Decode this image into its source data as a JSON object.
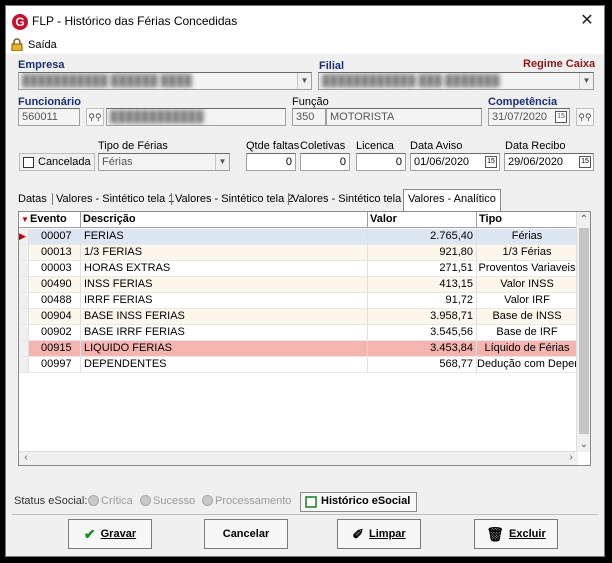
{
  "window": {
    "title": "FLP - Histórico das Férias Concedidas",
    "app_icon": "G"
  },
  "menu": {
    "exit_label": "Saída"
  },
  "labels": {
    "empresa": "Empresa",
    "filial": "Filial",
    "regime": "Regime Caixa",
    "funcionario": "Funcionário",
    "funcao": "Função",
    "competencia": "Competência",
    "tipo_ferias": "Tipo de Férias",
    "qtde_faltas": "Qtde faltas",
    "coletivas": "Coletivas",
    "licenca": "Licenca",
    "data_aviso": "Data Aviso",
    "data_recibo": "Data Recibo"
  },
  "fields": {
    "empresa": "███████████ ██████ ████",
    "filial": "████████████ ███ ███████",
    "funcionario_codigo": "560011",
    "funcionario_nome": "████████████",
    "funcao_codigo": "350",
    "funcao_nome": "MOTORISTA",
    "competencia": "31/07/2020",
    "tipo_ferias": "Férias",
    "qtde_faltas": "0",
    "coletivas": "0",
    "licenca": "0",
    "data_aviso": "01/06/2020",
    "data_recibo": "29/06/2020",
    "cancelada_label": "Cancelada"
  },
  "tabs": [
    "Datas",
    "Valores - Sintético tela 1",
    "Valores - Sintético tela 2",
    "Valores - Sintético tela 3",
    "Valores - Analítico"
  ],
  "grid": {
    "headers": [
      "Evento",
      "Descrição",
      "Valor",
      "Tipo"
    ],
    "rows": [
      {
        "evento": "00007",
        "descricao": "FERIAS",
        "valor": "2.765,40",
        "tipo": "Férias"
      },
      {
        "evento": "00013",
        "descricao": "1/3 FERIAS",
        "valor": "921,80",
        "tipo": "1/3 Férias"
      },
      {
        "evento": "00003",
        "descricao": "HORAS EXTRAS",
        "valor": "271,51",
        "tipo": "Proventos Variaveis"
      },
      {
        "evento": "00490",
        "descricao": "INSS FERIAS",
        "valor": "413,15",
        "tipo": "Valor INSS"
      },
      {
        "evento": "00488",
        "descricao": "IRRF FERIAS",
        "valor": "91,72",
        "tipo": "Valor IRF"
      },
      {
        "evento": "00904",
        "descricao": "BASE INSS FERIAS",
        "valor": "3.958,71",
        "tipo": "Base de INSS"
      },
      {
        "evento": "00902",
        "descricao": "BASE IRRF FERIAS",
        "valor": "3.545,56",
        "tipo": "Base de IRF"
      },
      {
        "evento": "00915",
        "descricao": "LIQUIDO FERIAS",
        "valor": "3.453,84",
        "tipo": "Líquido de Férias"
      },
      {
        "evento": "00997",
        "descricao": "DEPENDENTES",
        "valor": "568,77",
        "tipo": "Dedução com Depende"
      }
    ]
  },
  "status": {
    "label": "Status eSocial:",
    "critica": "Crítica",
    "sucesso": "Sucesso",
    "processamento": "Processamento",
    "historico": "Histórico eSocial"
  },
  "buttons": {
    "gravar": "Gravar",
    "cancelar": "Cancelar",
    "limpar": "Limpar",
    "excluir": "Excluir"
  },
  "colors": {
    "selected_row": "#dde6f3",
    "alt_row": "#fdf6ea",
    "highlight_row": "#f6b4b0",
    "header_label": "#1a2f7a",
    "regime_label": "#8b1a1a"
  },
  "icons": {
    "close": "close-icon",
    "exit": "lock-icon",
    "search": "binoculars-icon",
    "calendar": "calendar-icon",
    "row_pointer": "triangle-right-icon"
  }
}
